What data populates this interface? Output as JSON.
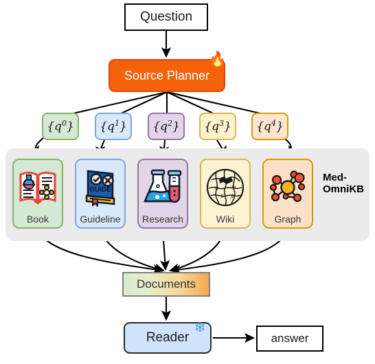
{
  "diagram": {
    "title_nodes": {
      "question": "Question",
      "planner": "Source Planner",
      "planner_icon": "fire-icon",
      "documents": "Documents",
      "reader": "Reader",
      "reader_icon": "snowflake-icon",
      "answer": "answer",
      "kb_label_line1": "Med-",
      "kb_label_line2": "OmniKB"
    },
    "queries": [
      {
        "base": "{q",
        "sup": "0",
        "close": "}",
        "fill": "#d5e8d4",
        "border": "#82b366"
      },
      {
        "base": "{q",
        "sup": "1",
        "close": "}",
        "fill": "#dae8fc",
        "border": "#7ea6e0"
      },
      {
        "base": "{q",
        "sup": "2",
        "close": "}",
        "fill": "#e1d5e7",
        "border": "#9673a6"
      },
      {
        "base": "{q",
        "sup": "3",
        "close": "}",
        "fill": "#fff2cc",
        "border": "#d6b656"
      },
      {
        "base": "{q",
        "sup": "4",
        "close": "}",
        "fill": "#fde5cf",
        "border": "#d79b00"
      }
    ],
    "sources": [
      {
        "label": "Book",
        "icon": "open-book-icon",
        "fill": "#d5e8d4",
        "border": "#82b366"
      },
      {
        "label": "Guideline",
        "icon": "guide-book-icon",
        "fill": "#dae8fc",
        "border": "#7ea6e0"
      },
      {
        "label": "Research",
        "icon": "flask-icon",
        "fill": "#e1d5e7",
        "border": "#9673a6"
      },
      {
        "label": "Wiki",
        "icon": "wikipedia-globe-icon",
        "fill": "#fdf3d3",
        "border": "#d6b656"
      },
      {
        "label": "Graph",
        "icon": "knowledge-graph-icon",
        "fill": "#fde0c8",
        "border": "#d79b00"
      }
    ],
    "colors": {
      "planner_fill": "#f4620c",
      "reader_fill": "#cfe4fa",
      "panel_fill": "#ebebeb",
      "documents_gradient_from": "#d9ead3",
      "documents_gradient_to": "#f3a950"
    }
  }
}
